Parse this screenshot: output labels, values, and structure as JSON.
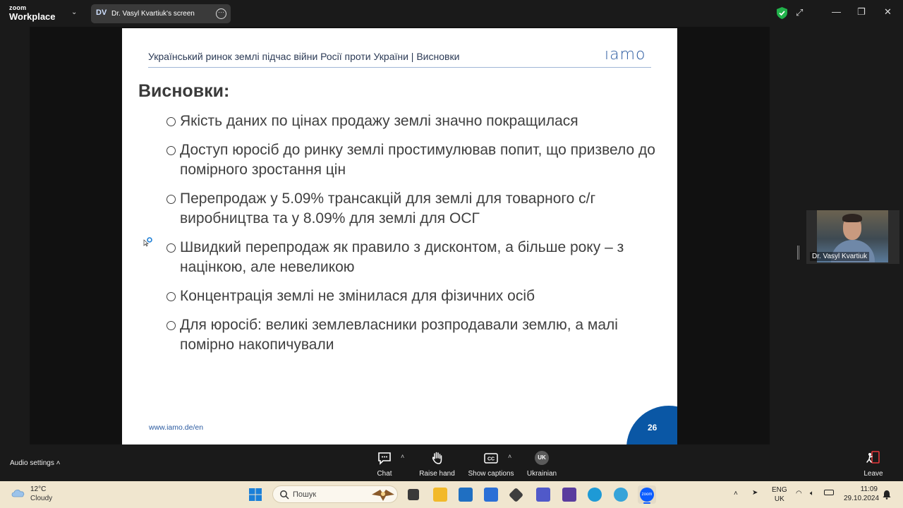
{
  "app": {
    "brand_top": "zoom",
    "brand_bottom": "Workplace",
    "share_initials": "DV",
    "share_title": "Dr. Vasyl Kvartiuk's screen"
  },
  "slide": {
    "header": "Український ринок землі підчас війни Росії проти України | Висновки",
    "logo": "ıamo",
    "title": "Висновки:",
    "bullets": [
      "Якість даних по цінах продажу землі значно покращилася",
      "Доступ юросіб до ринку землі простимулював попит, що призвело до помірного зростання цін",
      "Перепродаж у 5.09% трансакцій для землі для товарного с/г виробництва та у 8.09% для землі для ОСГ",
      "Швидкий перепродаж як правило з дисконтом, а більше року – з націнкою, але невеликою",
      "Концентрація землі не змінилася для фізичних осіб",
      "Для юросіб: великі землевласники розпродавали землю, а малі помірно накопичували"
    ],
    "url": "www.iamo.de/en",
    "page_number": "26"
  },
  "participant": {
    "name": "Dr. Vasyl Kvartiuk"
  },
  "toolbar": {
    "audio_settings": "Audio settings",
    "chat": "Chat",
    "raise_hand": "Raise hand",
    "show_captions": "Show captions",
    "language_badge": "UK",
    "language": "Ukrainian",
    "leave": "Leave"
  },
  "taskbar": {
    "temperature": "12°C",
    "condition": "Cloudy",
    "search_placeholder": "Пошук",
    "lang_top": "ENG",
    "lang_bottom": "UK",
    "time": "11:09",
    "date": "29.10.2024"
  },
  "colors": {
    "accent_blue": "#0a57a5",
    "zoom_blue": "#0b5cff",
    "shield_green": "#21b24b",
    "leave_red": "#e5383b"
  }
}
